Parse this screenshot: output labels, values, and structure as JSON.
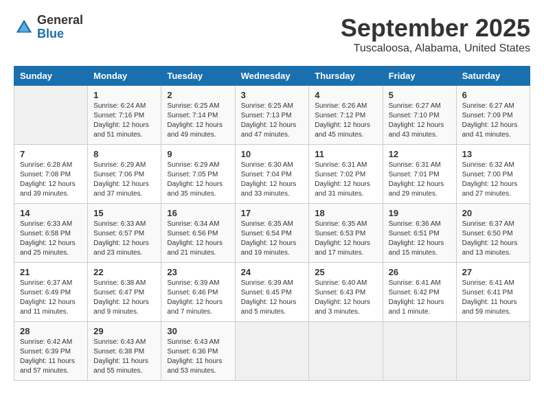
{
  "header": {
    "logo_general": "General",
    "logo_blue": "Blue",
    "title": "September 2025",
    "subtitle": "Tuscaloosa, Alabama, United States"
  },
  "days_of_week": [
    "Sunday",
    "Monday",
    "Tuesday",
    "Wednesday",
    "Thursday",
    "Friday",
    "Saturday"
  ],
  "weeks": [
    [
      {
        "day": "",
        "info": ""
      },
      {
        "day": "1",
        "info": "Sunrise: 6:24 AM\nSunset: 7:16 PM\nDaylight: 12 hours\nand 51 minutes."
      },
      {
        "day": "2",
        "info": "Sunrise: 6:25 AM\nSunset: 7:14 PM\nDaylight: 12 hours\nand 49 minutes."
      },
      {
        "day": "3",
        "info": "Sunrise: 6:25 AM\nSunset: 7:13 PM\nDaylight: 12 hours\nand 47 minutes."
      },
      {
        "day": "4",
        "info": "Sunrise: 6:26 AM\nSunset: 7:12 PM\nDaylight: 12 hours\nand 45 minutes."
      },
      {
        "day": "5",
        "info": "Sunrise: 6:27 AM\nSunset: 7:10 PM\nDaylight: 12 hours\nand 43 minutes."
      },
      {
        "day": "6",
        "info": "Sunrise: 6:27 AM\nSunset: 7:09 PM\nDaylight: 12 hours\nand 41 minutes."
      }
    ],
    [
      {
        "day": "7",
        "info": "Sunrise: 6:28 AM\nSunset: 7:08 PM\nDaylight: 12 hours\nand 39 minutes."
      },
      {
        "day": "8",
        "info": "Sunrise: 6:29 AM\nSunset: 7:06 PM\nDaylight: 12 hours\nand 37 minutes."
      },
      {
        "day": "9",
        "info": "Sunrise: 6:29 AM\nSunset: 7:05 PM\nDaylight: 12 hours\nand 35 minutes."
      },
      {
        "day": "10",
        "info": "Sunrise: 6:30 AM\nSunset: 7:04 PM\nDaylight: 12 hours\nand 33 minutes."
      },
      {
        "day": "11",
        "info": "Sunrise: 6:31 AM\nSunset: 7:02 PM\nDaylight: 12 hours\nand 31 minutes."
      },
      {
        "day": "12",
        "info": "Sunrise: 6:31 AM\nSunset: 7:01 PM\nDaylight: 12 hours\nand 29 minutes."
      },
      {
        "day": "13",
        "info": "Sunrise: 6:32 AM\nSunset: 7:00 PM\nDaylight: 12 hours\nand 27 minutes."
      }
    ],
    [
      {
        "day": "14",
        "info": "Sunrise: 6:33 AM\nSunset: 6:58 PM\nDaylight: 12 hours\nand 25 minutes."
      },
      {
        "day": "15",
        "info": "Sunrise: 6:33 AM\nSunset: 6:57 PM\nDaylight: 12 hours\nand 23 minutes."
      },
      {
        "day": "16",
        "info": "Sunrise: 6:34 AM\nSunset: 6:56 PM\nDaylight: 12 hours\nand 21 minutes."
      },
      {
        "day": "17",
        "info": "Sunrise: 6:35 AM\nSunset: 6:54 PM\nDaylight: 12 hours\nand 19 minutes."
      },
      {
        "day": "18",
        "info": "Sunrise: 6:35 AM\nSunset: 6:53 PM\nDaylight: 12 hours\nand 17 minutes."
      },
      {
        "day": "19",
        "info": "Sunrise: 6:36 AM\nSunset: 6:51 PM\nDaylight: 12 hours\nand 15 minutes."
      },
      {
        "day": "20",
        "info": "Sunrise: 6:37 AM\nSunset: 6:50 PM\nDaylight: 12 hours\nand 13 minutes."
      }
    ],
    [
      {
        "day": "21",
        "info": "Sunrise: 6:37 AM\nSunset: 6:49 PM\nDaylight: 12 hours\nand 11 minutes."
      },
      {
        "day": "22",
        "info": "Sunrise: 6:38 AM\nSunset: 6:47 PM\nDaylight: 12 hours\nand 9 minutes."
      },
      {
        "day": "23",
        "info": "Sunrise: 6:39 AM\nSunset: 6:46 PM\nDaylight: 12 hours\nand 7 minutes."
      },
      {
        "day": "24",
        "info": "Sunrise: 6:39 AM\nSunset: 6:45 PM\nDaylight: 12 hours\nand 5 minutes."
      },
      {
        "day": "25",
        "info": "Sunrise: 6:40 AM\nSunset: 6:43 PM\nDaylight: 12 hours\nand 3 minutes."
      },
      {
        "day": "26",
        "info": "Sunrise: 6:41 AM\nSunset: 6:42 PM\nDaylight: 12 hours\nand 1 minute."
      },
      {
        "day": "27",
        "info": "Sunrise: 6:41 AM\nSunset: 6:41 PM\nDaylight: 11 hours\nand 59 minutes."
      }
    ],
    [
      {
        "day": "28",
        "info": "Sunrise: 6:42 AM\nSunset: 6:39 PM\nDaylight: 11 hours\nand 57 minutes."
      },
      {
        "day": "29",
        "info": "Sunrise: 6:43 AM\nSunset: 6:38 PM\nDaylight: 11 hours\nand 55 minutes."
      },
      {
        "day": "30",
        "info": "Sunrise: 6:43 AM\nSunset: 6:36 PM\nDaylight: 11 hours\nand 53 minutes."
      },
      {
        "day": "",
        "info": ""
      },
      {
        "day": "",
        "info": ""
      },
      {
        "day": "",
        "info": ""
      },
      {
        "day": "",
        "info": ""
      }
    ]
  ]
}
